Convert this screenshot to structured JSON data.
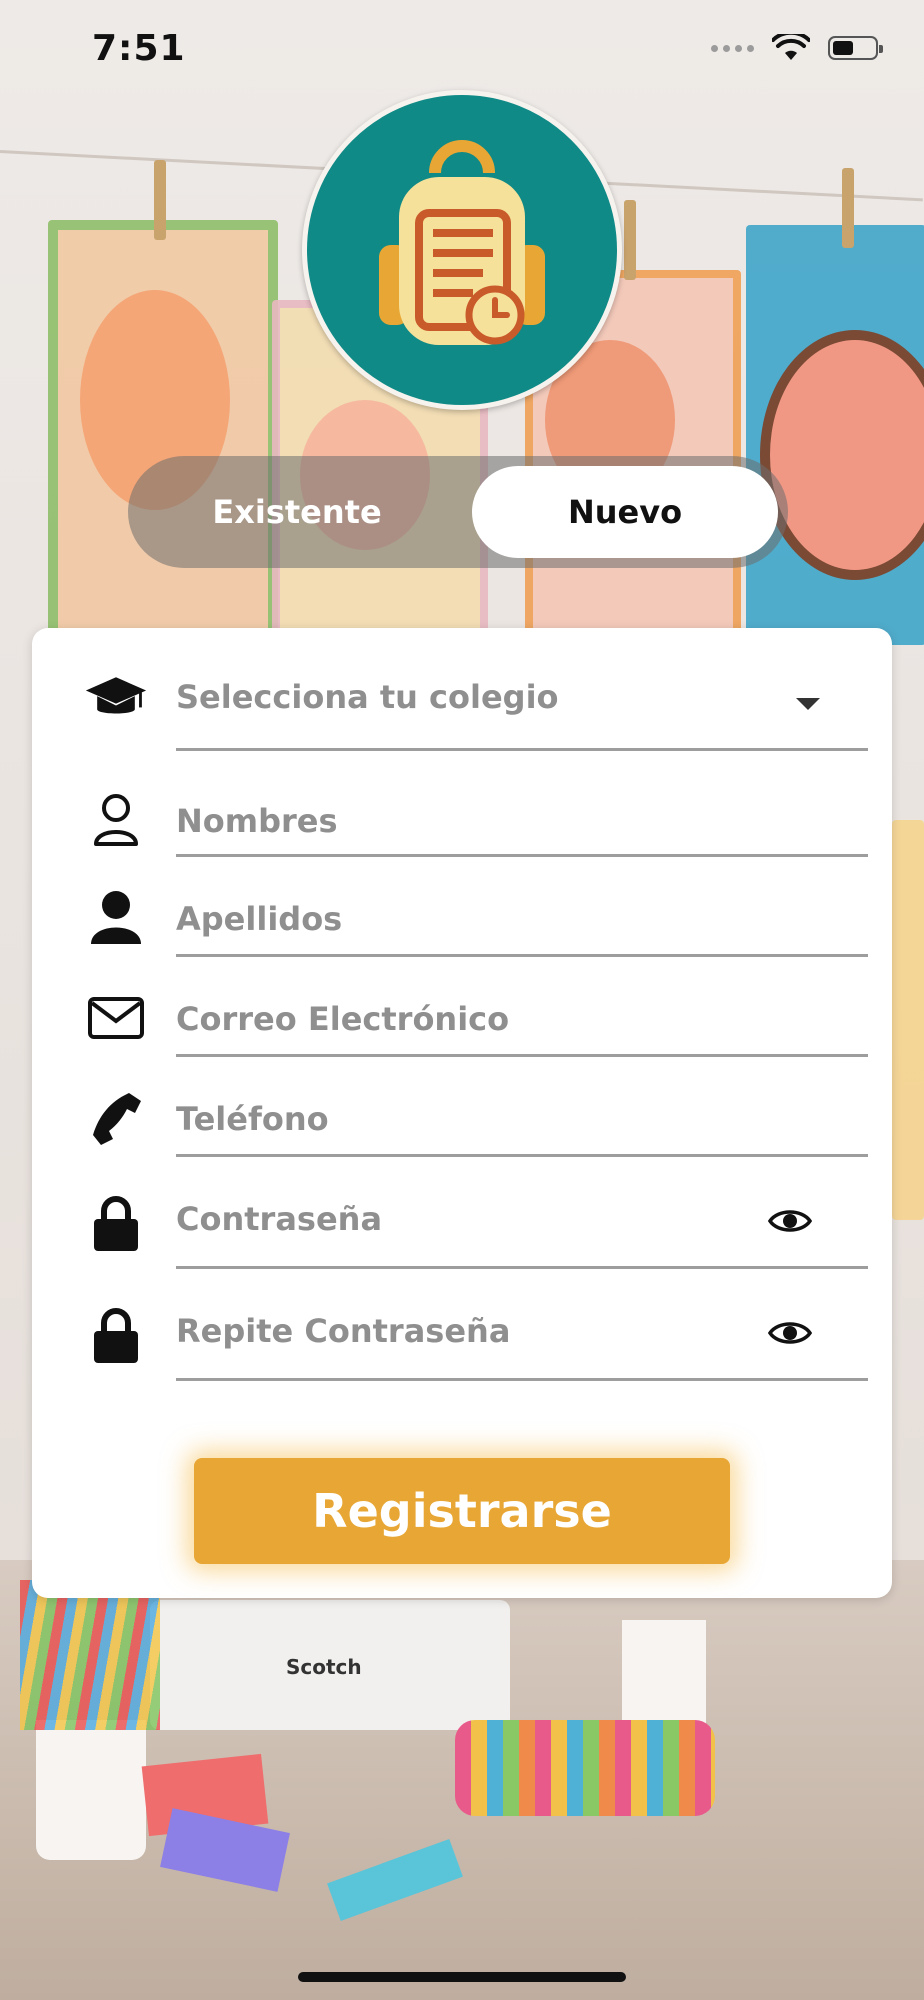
{
  "status_bar": {
    "time": "7:51"
  },
  "segment": {
    "existing_label": "Existente",
    "new_label": "Nuevo",
    "selected": "Nuevo"
  },
  "form": {
    "school_select": {
      "placeholder": "Selecciona tu colegio"
    },
    "first_name": {
      "placeholder": "Nombres",
      "value": ""
    },
    "last_name": {
      "placeholder": "Apellidos",
      "value": ""
    },
    "email": {
      "placeholder": "Correo Electrónico",
      "value": ""
    },
    "phone": {
      "placeholder": "Teléfono",
      "value": ""
    },
    "password": {
      "placeholder": "Contraseña",
      "value": ""
    },
    "repeat_password": {
      "placeholder": "Repite Contraseña",
      "value": ""
    },
    "submit_label": "Registrarse"
  },
  "colors": {
    "accent": "#e8a735",
    "logo_bg": "#0f8a86",
    "logo_bag": "#f6e19a",
    "logo_doc": "#c95a2a"
  },
  "background_text": {
    "tape_brand": "Scotch"
  },
  "icons": [
    "graduation-cap-icon",
    "user-outline-icon",
    "user-filled-icon",
    "mail-icon",
    "phone-icon",
    "lock-icon",
    "eye-icon",
    "backpack-clock-icon"
  ]
}
